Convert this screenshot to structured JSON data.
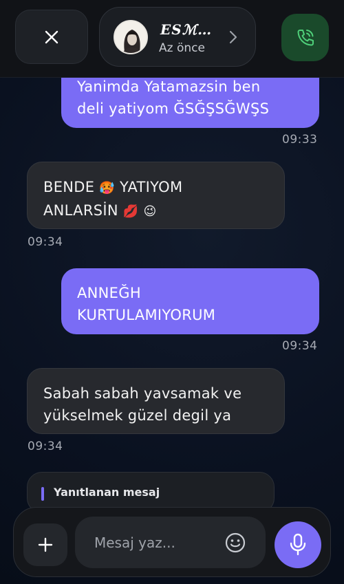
{
  "header": {
    "contact_name": "ESℳ…",
    "contact_status": "Az önce",
    "icons": {
      "close": "close-icon",
      "chevron": "chevron-right-icon",
      "call": "phone-call-icon"
    },
    "call_color": "#1a4a2b"
  },
  "messages": [
    {
      "direction": "outgoing",
      "lines": [
        "Yanimda Yatamazsin ben",
        "deli yatiyom ĞSĞŞSĞWŞS"
      ],
      "time": "09:33"
    },
    {
      "direction": "incoming",
      "line1_text": "BENDE",
      "line1_emoji": "🥵",
      "line1_text2": "YATIYOM",
      "line2_text": "ANLARSİN",
      "line2_emoji1": "💋",
      "line2_emoji2": "😉",
      "time": "09:34"
    },
    {
      "direction": "outgoing",
      "lines": [
        "ANNEĞH",
        "KURTULAMIYORUM"
      ],
      "time": "09:34"
    },
    {
      "direction": "incoming",
      "lines": [
        "Sabah sabah yavsamak ve",
        "yükselmek güzel degil ya"
      ],
      "time": "09:34"
    }
  ],
  "reply_preview": {
    "label": "Yanıtlanan mesaj"
  },
  "composer": {
    "placeholder": "Mesaj yaz...",
    "icons": {
      "add": "plus-icon",
      "emoji": "smiley-icon",
      "mic": "microphone-icon"
    }
  },
  "colors": {
    "accent": "#7a6cf5",
    "incoming_bubble": "#27292e"
  }
}
